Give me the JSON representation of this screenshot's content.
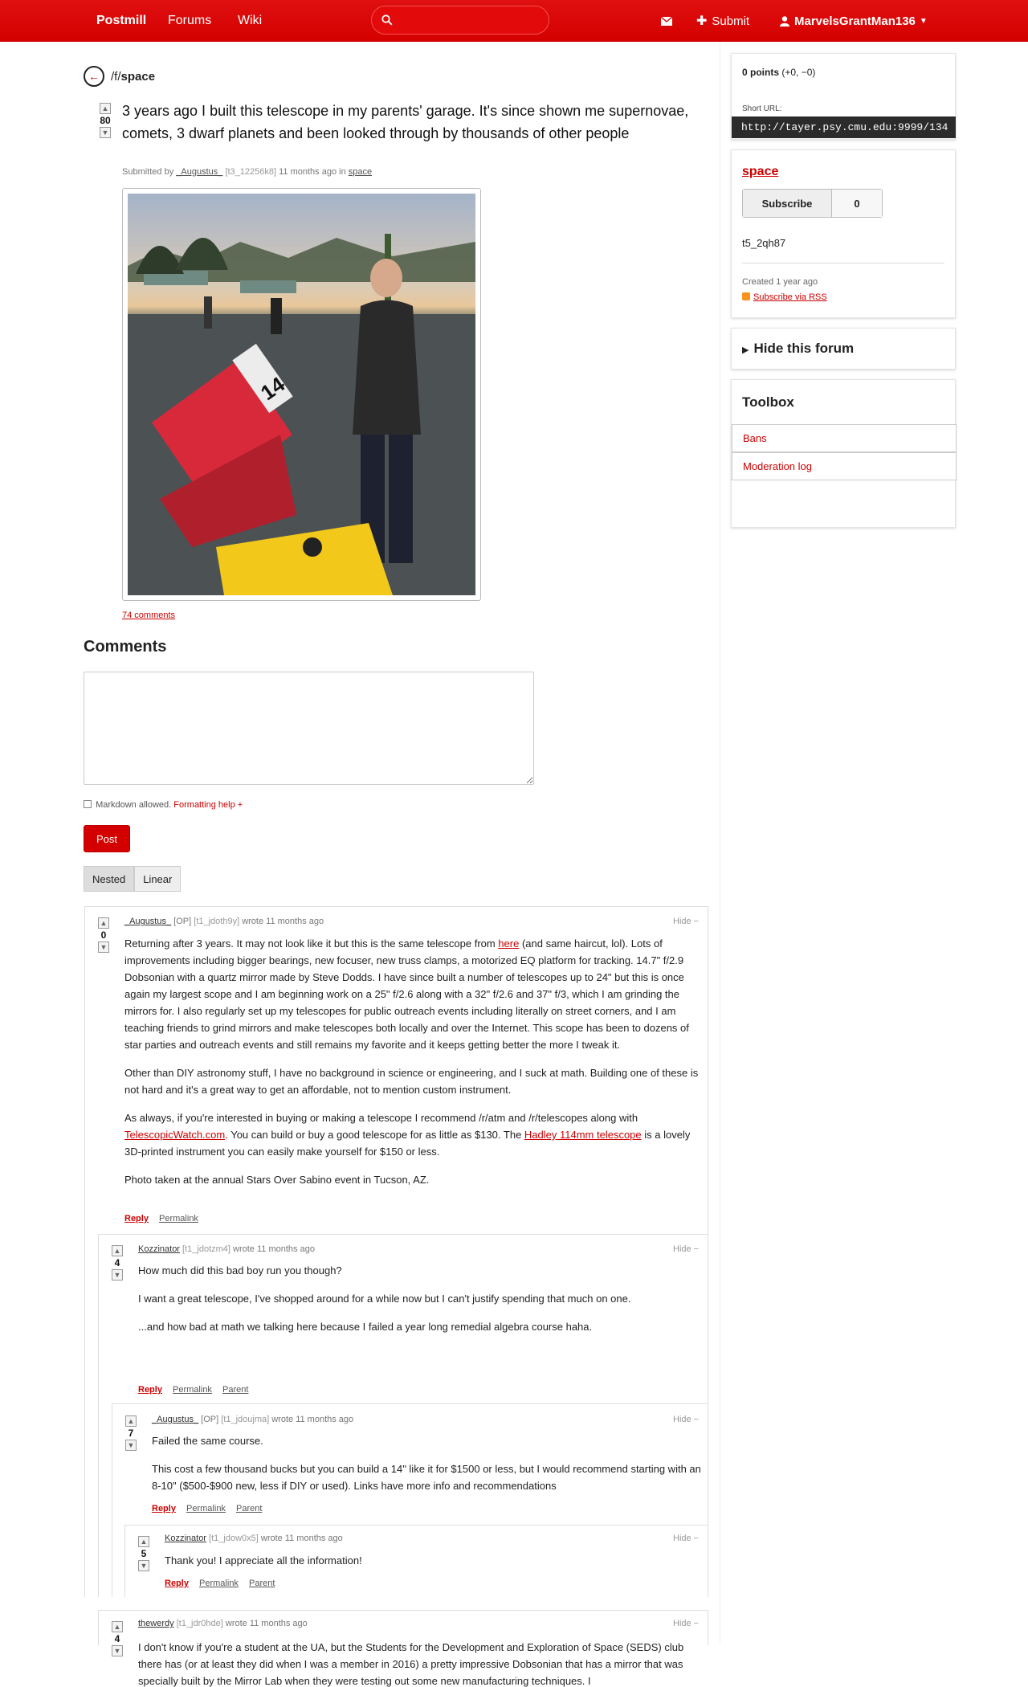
{
  "nav": {
    "brand": "Postmill",
    "forums": "Forums",
    "wiki": "Wiki",
    "search_placeholder": "",
    "submit": "Submit",
    "username": "MarvelsGrantMan136"
  },
  "crumb": {
    "prefix": "/f/",
    "forum": "space"
  },
  "post": {
    "score": "80",
    "title": "3 years ago I built this telescope in my parents' garage. It's since shown me supernovae, comets, 3 dwarf planets and been looked through by thousands of other people",
    "submitted_by": "Submitted by",
    "author": "_Augustus_",
    "author_id": "[t3_12256k8]",
    "age": "11 months ago in",
    "forum": "space",
    "comments_link": "74 comments"
  },
  "comments_section": {
    "heading": "Comments",
    "textarea_value": "",
    "markdown_note": "Markdown allowed.",
    "formatting_help": "Formatting help +",
    "post_button": "Post",
    "nested": "Nested",
    "linear": "Linear"
  },
  "comments": [
    {
      "score": "0",
      "author": "_Augustus_",
      "op": "[OP]",
      "uid": "[t1_jdoth9y]",
      "wrote": "wrote 11 months ago",
      "hide": "Hide −",
      "p1_a": "Returning after 3 years. It may not look like it but this is the same telescope from ",
      "p1_link": "here",
      "p1_b": " (and same haircut, lol). Lots of improvements including bigger bearings, new focuser, new truss clamps, a motorized EQ platform for tracking. 14.7\" f/2.9 Dobsonian with a quartz mirror made by Steve Dodds. I have since built a number of telescopes up to 24\" but this is once again my largest scope and I am beginning work on a 25\" f/2.6 along with a 32\" f/2.6 and 37\" f/3, which I am grinding the mirrors for. I also regularly set up my telescopes for public outreach events including literally on street corners, and I am teaching friends to grind mirrors and make telescopes both locally and over the Internet. This scope has been to dozens of star parties and outreach events and still remains my favorite and it keeps getting better the more I tweak it.",
      "p2": "Other than DIY astronomy stuff, I have no background in science or engineering, and I suck at math. Building one of these is not hard and it's a great way to get an affordable, not to mention custom instrument.",
      "p3_a": "As always, if you're interested in buying or making a telescope I recommend /r/atm and /r/telescopes along with ",
      "p3_link1": "TelescopicWatch.com",
      "p3_b": ". You can build or buy a good telescope for as little as $130. The ",
      "p3_link2": "Hadley 114mm telescope",
      "p3_c": " is a lovely 3D-printed instrument you can easily make yourself for $150 or less.",
      "p4": "Photo taken at the annual Stars Over Sabino event in Tucson, AZ.",
      "reply": "Reply",
      "permalink": "Permalink"
    },
    {
      "score": "4",
      "author": "Kozzinator",
      "uid": "[t1_jdotzm4]",
      "wrote": "wrote 11 months ago",
      "hide": "Hide −",
      "p1": "How much did this bad boy run you though?",
      "p2": "I want a great telescope, I've shopped around for a while now but I can't justify spending that much on one.",
      "p3": "...and how bad at math we talking here because I failed a year long remedial algebra course haha.",
      "reply": "Reply",
      "permalink": "Permalink",
      "parent": "Parent"
    },
    {
      "score": "7",
      "author": "_Augustus_",
      "op": "[OP]",
      "uid": "[t1_jdoujma]",
      "wrote": "wrote 11 months ago",
      "hide": "Hide −",
      "p1": "Failed the same course.",
      "p2": "This cost a few thousand bucks but you can build a 14\" like it for $1500 or less, but I would recommend starting with an 8-10\" ($500-$900 new, less if DIY or used). Links have more info and recommendations",
      "reply": "Reply",
      "permalink": "Permalink",
      "parent": "Parent"
    },
    {
      "score": "5",
      "author": "Kozzinator",
      "uid": "[t1_jdow0x5]",
      "wrote": "wrote 11 months ago",
      "hide": "Hide −",
      "p1": "Thank you! I appreciate all the information!",
      "reply": "Reply",
      "permalink": "Permalink",
      "parent": "Parent"
    },
    {
      "score": "4",
      "author": "thewerdy",
      "uid": "[t1_jdr0hde]",
      "wrote": "wrote 11 months ago",
      "hide": "Hide −",
      "p1": "I don't know if you're a student at the UA, but the Students for the Development and Exploration of Space (SEDS) club there has (or at least they did when I was a member in 2016) a pretty impressive Dobsonian that has a mirror that was specially built by the Mirror Lab when they were testing out some new manufacturing techniques. I"
    }
  ],
  "sidebar": {
    "points": "0 points",
    "points_detail": "(+0, −0)",
    "short_url_label": "Short URL:",
    "short_url": "http://tayer.psy.cmu.edu:9999/134",
    "forum_title": "space",
    "subscribe": "Subscribe",
    "subscriber_count": "0",
    "forum_id": "t5_2qh87",
    "created": "Created 1 year ago",
    "rss": "Subscribe via RSS",
    "hide_forum": "Hide this forum",
    "toolbox_title": "Toolbox",
    "bans": "Bans",
    "moderation_log": "Moderation log"
  },
  "colors": {
    "nav_red": "#d40000",
    "link_red": "#cc0000"
  }
}
